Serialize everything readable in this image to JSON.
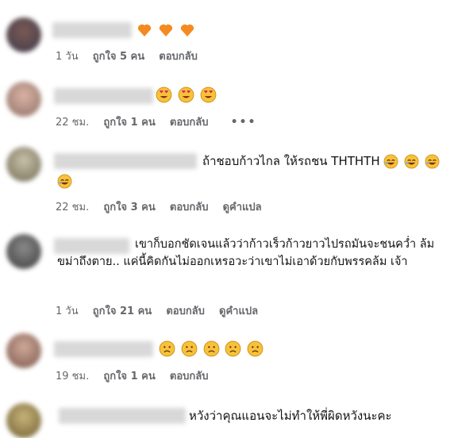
{
  "comments": [
    {
      "text": "",
      "emojis": [
        "heart-icon",
        "heart-icon",
        "heart-icon"
      ],
      "time": "1 วัน",
      "likes": "ถูกใจ 5 คน",
      "reply": "ตอบกลับ"
    },
    {
      "text": "",
      "emojis": [
        "heart-eyes-icon",
        "heart-eyes-icon",
        "heart-eyes-icon"
      ],
      "time": "22 ชม.",
      "likes": "ถูกใจ 1 คน",
      "reply": "ตอบกลับ",
      "more": "•••"
    },
    {
      "text": "ถ้าชอบก้าวไกล ให้รถชน THTHTH",
      "time": "22 ชม.",
      "likes": "ถูกใจ 3 คน",
      "reply": "ตอบกลับ",
      "translate": "ดูคำแปล"
    },
    {
      "text": "เขาก็บอกชัดเจนแล้วว่าก้าวเร็วก้าวยาวไปรถมันจะชนคว่ำ ล้มขม่าถึงตาย.. แค่นี้คิดกันไม่ออกเหรอวะว่าเขาไม่เอาด้วยกับพรรคล้ม เจ้า",
      "time": "1 วัน",
      "likes": "ถูกใจ 21 คน",
      "reply": "ตอบกลับ",
      "translate": "ดูคำแปล"
    },
    {
      "text": "",
      "time": "19 ชม.",
      "likes": "ถูกใจ 1 คน",
      "reply": "ตอบกลับ"
    },
    {
      "text": "หวังว่าคุณแอนจะไม่ทำให้พี่ผิดหวังนะคะ"
    }
  ],
  "colors": {
    "heart": "#f58a1f",
    "emoji_face": "#f7c23a",
    "meta": "#65676b"
  }
}
